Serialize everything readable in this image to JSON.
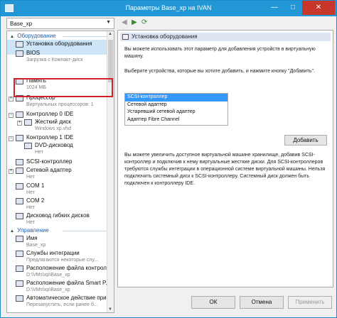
{
  "window": {
    "title": "Параметры Base_xp на IVAN",
    "min_glyph": "—",
    "max_glyph": "□",
    "close_glyph": "✕"
  },
  "vm_selector": {
    "value": "Base_xp"
  },
  "tree": {
    "sections": [
      {
        "label": "Оборудование",
        "toggle": "▲"
      },
      {
        "label": "Управление",
        "toggle": "▲"
      }
    ],
    "items": [
      {
        "label": "Установка оборудования",
        "sub": "",
        "icon": "hardware-install-icon"
      },
      {
        "label": "BIOS",
        "sub": "Загрузка с Компакт-диск",
        "icon": "bios-icon"
      },
      {
        "label": "Память",
        "sub": "1024 МБ",
        "icon": "memory-icon"
      },
      {
        "label": "Процессор",
        "sub": "Виртуальных процессоров: 1",
        "icon": "processor-icon",
        "exp": "+"
      },
      {
        "label": "Контроллер 0 IDE",
        "sub": "",
        "icon": "ide-controller-icon",
        "exp": "−"
      },
      {
        "label": "Жесткий диск",
        "sub": "Windows xp.vhd",
        "icon": "hard-disk-icon",
        "exp": "+"
      },
      {
        "label": "Контроллер 1 IDE",
        "sub": "",
        "icon": "ide-controller-icon",
        "exp": "−"
      },
      {
        "label": "DVD-дисковод",
        "sub": "Нет",
        "icon": "dvd-drive-icon"
      },
      {
        "label": "SCSI-контроллер",
        "sub": "",
        "icon": "scsi-controller-icon"
      },
      {
        "label": "Сетевой адаптер",
        "sub": "Нет",
        "icon": "network-adapter-icon",
        "exp": "+"
      },
      {
        "label": "COM 1",
        "sub": "Нет",
        "icon": "com-port-icon"
      },
      {
        "label": "COM 2",
        "sub": "Нет",
        "icon": "com-port-icon"
      },
      {
        "label": "Дисковод гибких дисков",
        "sub": "Нет",
        "icon": "floppy-drive-icon"
      },
      {
        "label": "Имя",
        "sub": "Base_xp",
        "icon": "name-icon"
      },
      {
        "label": "Службы интеграции",
        "sub": "Предлагаются некоторые слу...",
        "icon": "integration-services-icon"
      },
      {
        "label": "Расположение файла контрольн...",
        "sub": "D:\\VMs\\xp\\Base_xp",
        "icon": "snapshot-location-icon"
      },
      {
        "label": "Расположение файла Smart P...",
        "sub": "D:\\VMs\\xp\\Base_xp",
        "icon": "smart-paging-icon"
      },
      {
        "label": "Автоматическое действие при...",
        "sub": "Перезапустить, если ранее б...",
        "icon": "auto-start-icon"
      }
    ]
  },
  "toolbar": {
    "back": "◀",
    "forward": "▶",
    "refresh": "⟳"
  },
  "panel": {
    "header": "Установка оборудования",
    "p1": "Вы можете использовать этот параметр для добавления устройств в виртуальную машину.",
    "p2": "Выберите устройства, которые вы хотите добавить, и нажмите кнопку \"Добавить\".",
    "devices": [
      "SCSI-контроллер",
      "Сетевой адаптер",
      "Устаревший сетевой адаптер",
      "Адаптер Fibre Channel"
    ],
    "add_button": "Добавить",
    "p3": "Вы можете увеличить доступное виртуальной машине хранилище, добавив SCSI-контроллер и подключив к нему виртуальные жесткие диски. Для SCSI-контроллеров требуются службы интеграции в операционной системе виртуальной машины. Нельзя подключить системный диск к SCSI-контроллеру. Системный диск должен быть подключен к контроллеру IDE."
  },
  "buttons": {
    "ok": "ОК",
    "cancel": "Отмена",
    "apply": "Применить"
  },
  "colors": {
    "titlebar": "#2397d5",
    "highlight": "#d0202a",
    "selection": "#3399ff"
  }
}
